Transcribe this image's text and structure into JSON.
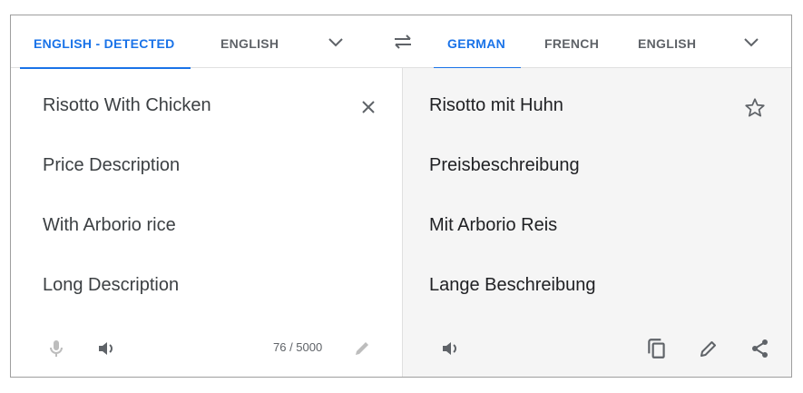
{
  "tabs_source": [
    {
      "label": "ENGLISH - DETECTED",
      "active": true
    },
    {
      "label": "ENGLISH",
      "active": false
    }
  ],
  "tabs_target": [
    {
      "label": "GERMAN",
      "active": true
    },
    {
      "label": "FRENCH",
      "active": false
    },
    {
      "label": "ENGLISH",
      "active": false
    }
  ],
  "source": {
    "lines": [
      "Risotto With Chicken",
      "Price Description",
      "With Arborio rice",
      "Long Description"
    ],
    "char_count": "76 / 5000"
  },
  "target": {
    "lines": [
      "Risotto mit Huhn",
      "Preisbeschreibung",
      "Mit Arborio Reis",
      "Lange Beschreibung"
    ]
  },
  "icons": {
    "source_more": "chevron-down-icon",
    "swap": "swap-languages-icon",
    "target_more": "chevron-down-icon",
    "clear": "close-icon",
    "mic": "microphone-icon",
    "source_listen": "speaker-icon",
    "handwrite": "pencil-icon",
    "star": "star-outline-icon",
    "target_listen": "speaker-icon",
    "copy": "copy-icon",
    "edit": "pencil-icon",
    "share": "share-icon"
  },
  "colors": {
    "accent": "#1a73e8",
    "text": "#3c4043",
    "icon": "#5f6368",
    "icon_disabled": "#bdbdbd",
    "target_bg": "#f5f5f5",
    "divider": "#e0e0e0"
  }
}
